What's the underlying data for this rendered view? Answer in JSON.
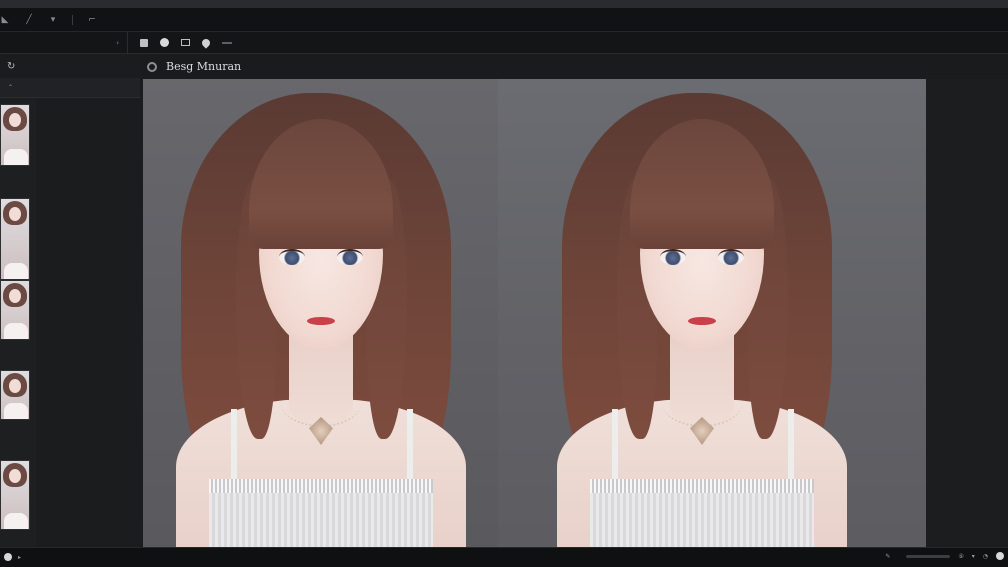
{
  "toolbar": {
    "tools": [
      "brush-tool",
      "pen-tool",
      "arrow-tool",
      "crop-tool"
    ],
    "menu_label": "",
    "sub_left_label": "",
    "sub_left_icon": "chevron-right-icon"
  },
  "side": {
    "header_icon": "refresh-icon",
    "filmstrip_label": "",
    "meta_group_a": [
      "",
      "",
      "",
      "",
      "",
      "",
      "",
      "",
      ""
    ],
    "meta_group_b": [
      "",
      "",
      "",
      ""
    ]
  },
  "viewer": {
    "title": "Besg Mnuran",
    "title_icon": "eye-icon"
  },
  "filmstrip": {
    "thumb_count": 5
  },
  "status": {
    "left_label": "",
    "right_label": "",
    "page_indicator": ""
  },
  "colors": {
    "background": "#1b1c1e",
    "panel_left": "#67676c",
    "panel_right": "#6b6c71",
    "hair": "#6f4539",
    "lips": "#c9404a"
  }
}
